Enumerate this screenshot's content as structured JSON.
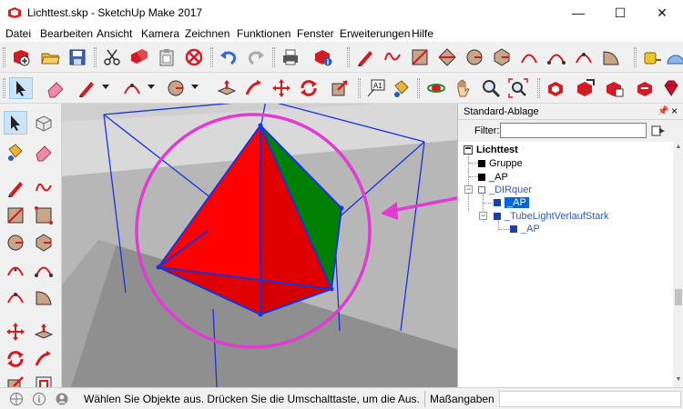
{
  "window": {
    "title": "Lichttest.skp - SketchUp Make 2017",
    "minimize_glyph": "—",
    "maximize_glyph": "☐",
    "close_glyph": "✕"
  },
  "menu": [
    "Datei",
    "Bearbeiten",
    "Ansicht",
    "Kamera",
    "Zeichnen",
    "Funktionen",
    "Fenster",
    "Erweiterungen",
    "Hilfe"
  ],
  "toolbar": {
    "row1_icons": [
      "new-file-icon",
      "open-folder-icon",
      "save-disk-icon",
      "cut-scissors-icon",
      "copy-icon",
      "paste-icon",
      "erase-delete-icon",
      "undo-arrow-icon",
      "redo-arrow-icon",
      "print-icon",
      "model-info-icon",
      "pencil-line-icon",
      "freehand-icon",
      "rectangle-icon",
      "rotated-rectangle-icon",
      "circle-icon",
      "polygon-icon",
      "arc-icon",
      "two-point-arc-icon",
      "three-point-arc-icon",
      "pie-icon",
      "tape-measure-icon",
      "protractor-icon"
    ],
    "row2_icons": [
      "select-arrow-icon",
      "eraser-icon",
      "line-pencil-icon",
      "arc-tool-icon",
      "circle-tool-icon",
      "push-pull-icon",
      "follow-me-icon",
      "move-icon",
      "rotate-icon",
      "scale-icon",
      "text-label-icon",
      "paint-bucket-icon",
      "orbit-icon",
      "pan-hand-icon",
      "zoom-icon",
      "zoom-extents-icon",
      "warehouse-icon",
      "share-model-icon",
      "extension-warehouse-icon",
      "layout-icon",
      "ruby-gem-icon"
    ]
  },
  "palette_icons": [
    "select-arrow-icon",
    "make-component-icon",
    "paint-bucket-icon",
    "eraser-icon",
    "pencil-icon",
    "freehand-icon",
    "rectangle-icon",
    "rotated-rectangle-icon",
    "circle-icon",
    "polygon-icon",
    "arc-icon",
    "two-point-arc-icon",
    "three-point-arc-icon",
    "pie-icon",
    "move-icon",
    "push-pull-icon",
    "rotate-icon",
    "follow-me-icon",
    "scale-icon",
    "offset-icon"
  ],
  "text_tool_label": "A1",
  "panel": {
    "title": "Standard-Ablage",
    "pin_glyph": "📌",
    "close_glyph": "×",
    "filter_label": "Filter:",
    "filter_value": "",
    "tree": {
      "root": "Lichttest",
      "items": [
        {
          "label": "Gruppe",
          "level": 1
        },
        {
          "label": "_AP",
          "level": 1
        },
        {
          "label": "_DIRquer",
          "level": 1
        },
        {
          "label": "_AP",
          "level": 2,
          "selected": true
        },
        {
          "label": "_TubeLightVerlaufStark",
          "level": 2
        },
        {
          "label": "_AP",
          "level": 3
        }
      ]
    },
    "scroll_up_glyph": "▲",
    "scroll_down_glyph": "▼",
    "expander_glyph": "−"
  },
  "status": {
    "icons": [
      "geo-location-icon",
      "credits-icon",
      "user-account-icon"
    ],
    "message": "Wählen Sie Objekte aus. Drücken Sie die Umschalttaste, um die Aus...",
    "measurements_label": "Maßangaben",
    "measurements_value": ""
  },
  "colors": {
    "face_red": "#ff0000",
    "face_green": "#008a00",
    "edge_blue": "#1733e0",
    "annotation_magenta": "#e23ad4",
    "selection_blue": "#0a64d8"
  }
}
